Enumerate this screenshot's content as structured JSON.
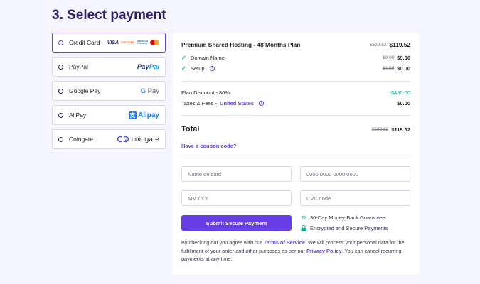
{
  "page": {
    "title": "3. Select payment"
  },
  "methods": [
    {
      "label": "Credit Card",
      "selected": true
    },
    {
      "label": "PayPal",
      "selected": false
    },
    {
      "label": "Google Pay",
      "selected": false
    },
    {
      "label": "AliPay",
      "selected": false
    },
    {
      "label": "Coingate",
      "selected": false
    }
  ],
  "logos": {
    "visa": "VISA",
    "discover": "DISCOVER",
    "amex_1": "AMERICAN",
    "amex_2": "EXPRESS",
    "paypal_pay": "Pay",
    "paypal_pal": "Pal",
    "gpay_g": "G",
    "gpay_text": "Pay",
    "alipay_mark": "支",
    "alipay_text": "Alipay",
    "coingate_text": "coingate"
  },
  "summary": {
    "plan_name": "Premium Shared Hosting - 48 Months Plan",
    "plan_old": "$599.52",
    "plan_price": "$119.52",
    "domain_label": "Domain Name",
    "domain_old": "$9.99",
    "domain_price": "$0.00",
    "setup_label": "Setup",
    "setup_old": "$4.99",
    "setup_price": "$0.00",
    "discount_label": "Plan Discount - 80%",
    "discount_value": "-$480.00",
    "taxes_label": "Taxes & Fees -",
    "taxes_country": "United States",
    "taxes_value": "$0.00",
    "total_label": "Total",
    "total_old": "$599.52",
    "total_price": "$119.52",
    "coupon_link": "Have a coupon code?"
  },
  "form": {
    "name_placeholder": "Name on card",
    "card_placeholder": "0000 0000 0000 0000",
    "expiry_placeholder": "MM / YY",
    "cvc_placeholder": "CVC code",
    "submit_label": "Submit Secure Payment"
  },
  "guarantees": {
    "money_back": "30-Day Money-Back Guarantee",
    "secure": "Encrypted and Secure Payments"
  },
  "legal": {
    "part1": "By checking out you agree with our ",
    "terms_link": "Terms of Service",
    "part2": ". We will process your personal data for the fulfillment of your order and other purposes as per our ",
    "privacy_link": "Privacy Policy",
    "part3": ". You can cancel recurring payments at any time."
  },
  "colors": {
    "accent": "#673de6",
    "success": "#00b090",
    "background": "#f4f5ff",
    "heading": "#2f1c6a"
  }
}
